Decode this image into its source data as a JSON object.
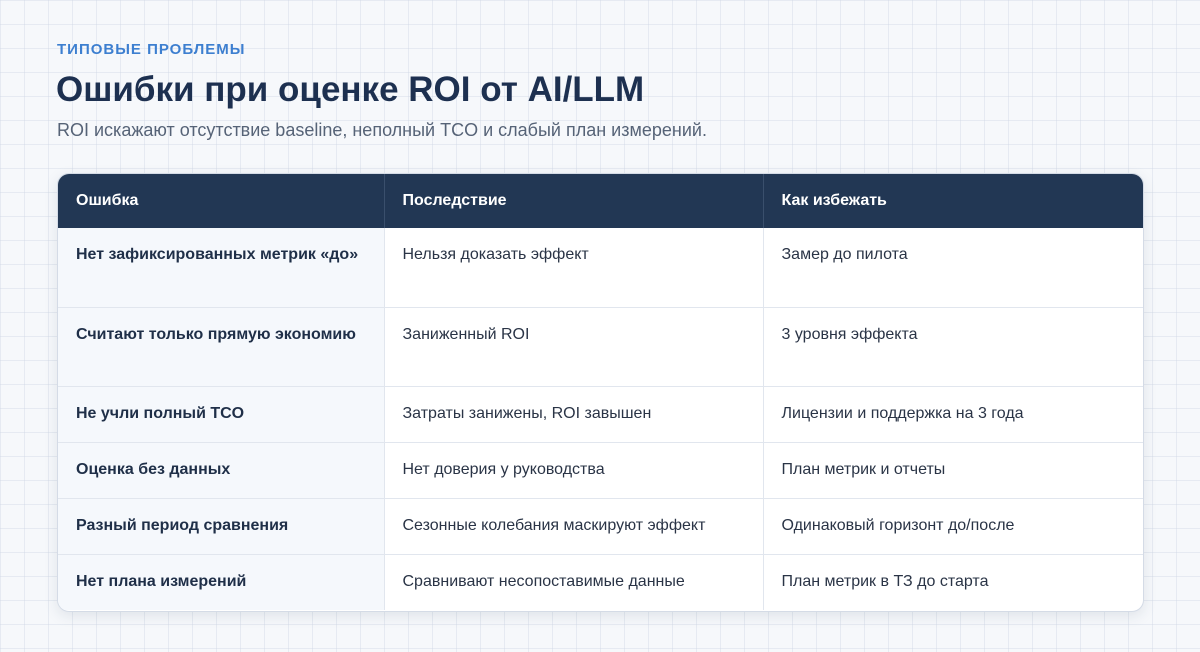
{
  "header": {
    "eyebrow": "ТИПОВЫЕ ПРОБЛЕМЫ",
    "title": "Ошибки при оценке ROI от AI/LLM",
    "subtitle": "ROI искажают отсутствие baseline, неполный TCO и слабый план измерений."
  },
  "table": {
    "columns": [
      "Ошибка",
      "Последствие",
      "Как избежать"
    ],
    "rows": [
      {
        "error": "Нет зафиксированных метрик «до»",
        "consequence": "Нельзя доказать эффект",
        "fix": "Замер до пилота"
      },
      {
        "error": "Считают только прямую экономию",
        "consequence": "Заниженный ROI",
        "fix": "3 уровня эффекта"
      },
      {
        "error": "Не учли полный TCO",
        "consequence": "Затраты занижены, ROI завышен",
        "fix": "Лицензии и поддержка на 3 года"
      },
      {
        "error": "Оценка без данных",
        "consequence": "Нет доверия у руководства",
        "fix": "План метрик и отчеты"
      },
      {
        "error": "Разный период сравнения",
        "consequence": "Сезонные колебания маскируют эффект",
        "fix": "Одинаковый горизонт до/после"
      },
      {
        "error": "Нет плана измерений",
        "consequence": "Сравнивают несопоставимые данные",
        "fix": "План метрик в ТЗ до старта"
      }
    ]
  }
}
